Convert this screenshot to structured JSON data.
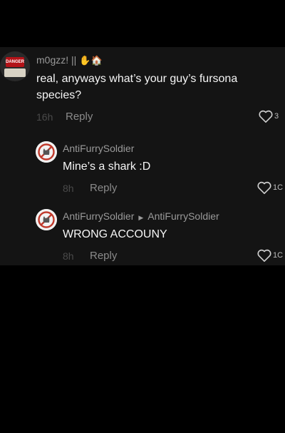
{
  "comments": [
    {
      "username": "m0gzz! ||",
      "username_icons": "✋🏠",
      "text": "real, anyways what’s your guy’s fursona species?",
      "time": "16h",
      "reply_label": "Reply",
      "likes": "3"
    },
    {
      "username": "AntiFurrySoldier",
      "text": "Mine’s a shark :D",
      "time": "8h",
      "reply_label": "Reply",
      "likes": "1C"
    },
    {
      "username": "AntiFurrySoldier",
      "reply_to": "AntiFurrySoldier",
      "text": "WRONG ACCOUNY",
      "time": "8h",
      "reply_label": "Reply",
      "likes": "1C"
    }
  ],
  "avatar_main_text": "DANGER",
  "colors": {
    "background": "#000000",
    "panel": "#141414",
    "username": "#9a9a9a",
    "no_furry_red": "#c0392b"
  }
}
